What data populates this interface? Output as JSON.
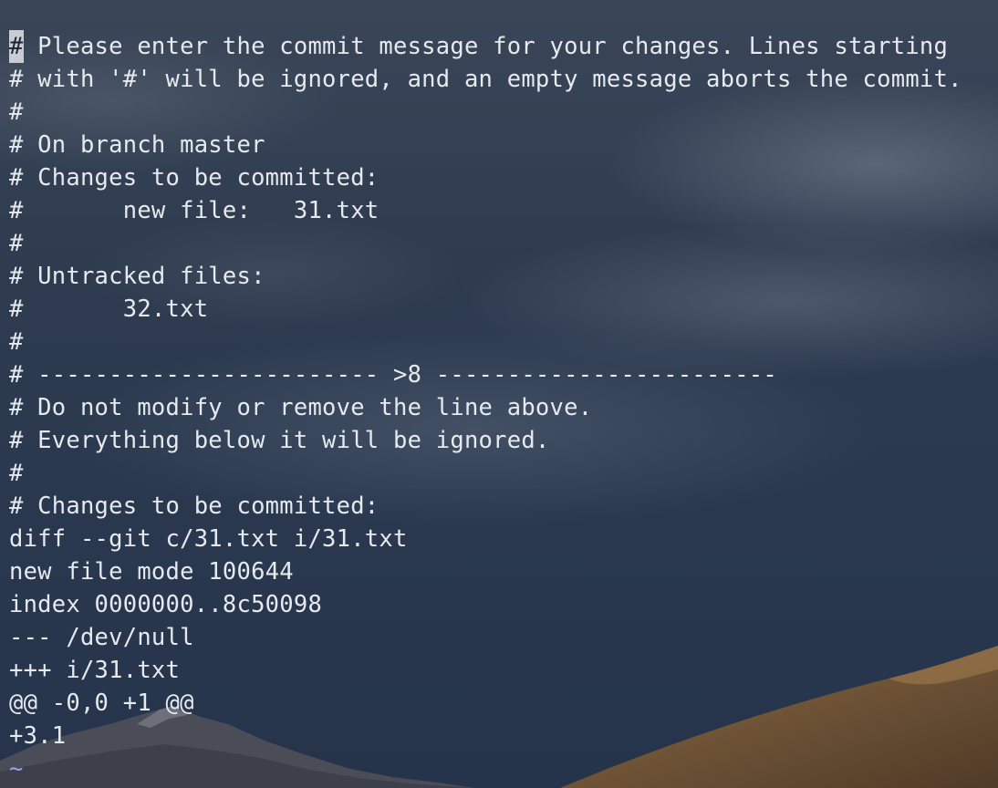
{
  "editor": {
    "cursor_char": "#",
    "lines": [
      " Please enter the commit message for your changes. Lines starting",
      "# with '#' will be ignored, and an empty message aborts the commit.",
      "#",
      "# On branch master",
      "# Changes to be committed:",
      "#       new file:   31.txt",
      "#",
      "# Untracked files:",
      "#       32.txt",
      "#",
      "# ------------------------ >8 ------------------------",
      "# Do not modify or remove the line above.",
      "# Everything below it will be ignored.",
      "#",
      "# Changes to be committed:",
      "diff --git c/31.txt i/31.txt",
      "new file mode 100644",
      "index 0000000..8c50098",
      "--- /dev/null",
      "+++ i/31.txt",
      "@@ -0,0 +1 @@",
      "+3.1"
    ],
    "empty_line_marker": "~",
    "colors": {
      "text": "#e6e9ee",
      "tilde": "#9b9ff0",
      "cursor": "#c9ccd2"
    }
  }
}
